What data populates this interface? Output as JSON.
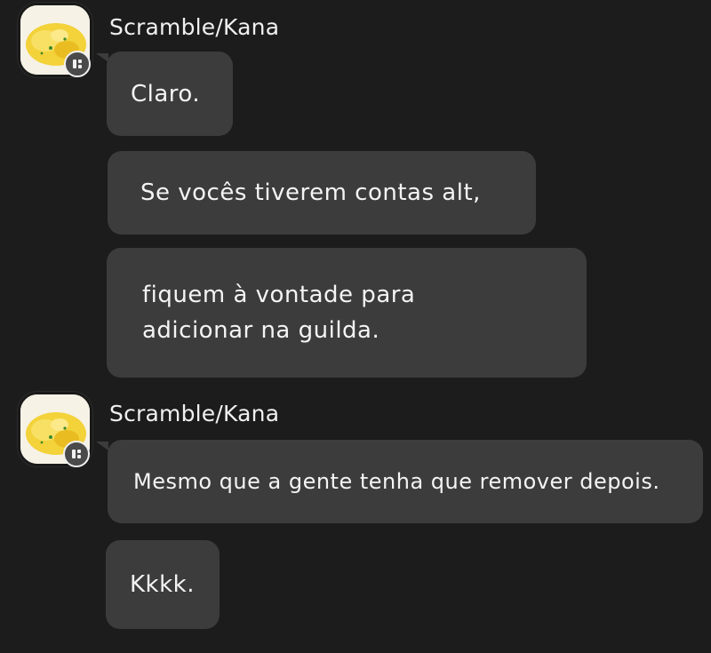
{
  "messages": [
    {
      "author": "Scramble/Kana",
      "avatar_icon": "scrambled-eggs-avatar-icon",
      "badge_icon": "level-badge-icon",
      "bubbles": [
        {
          "text": "Claro."
        },
        {
          "text": "Se vocês tiverem contas alt,"
        },
        {
          "text": "fiquem à vontade para\nadicionar na guilda."
        }
      ]
    },
    {
      "author": "Scramble/Kana",
      "avatar_icon": "scrambled-eggs-avatar-icon",
      "badge_icon": "level-badge-icon",
      "bubbles": [
        {
          "text": "Mesmo que a gente tenha que remover depois."
        },
        {
          "text": "Kkkk."
        }
      ]
    }
  ],
  "colors": {
    "background": "#1c1c1c",
    "bubble": "#3c3c3c",
    "text": "#f4f4f4"
  }
}
